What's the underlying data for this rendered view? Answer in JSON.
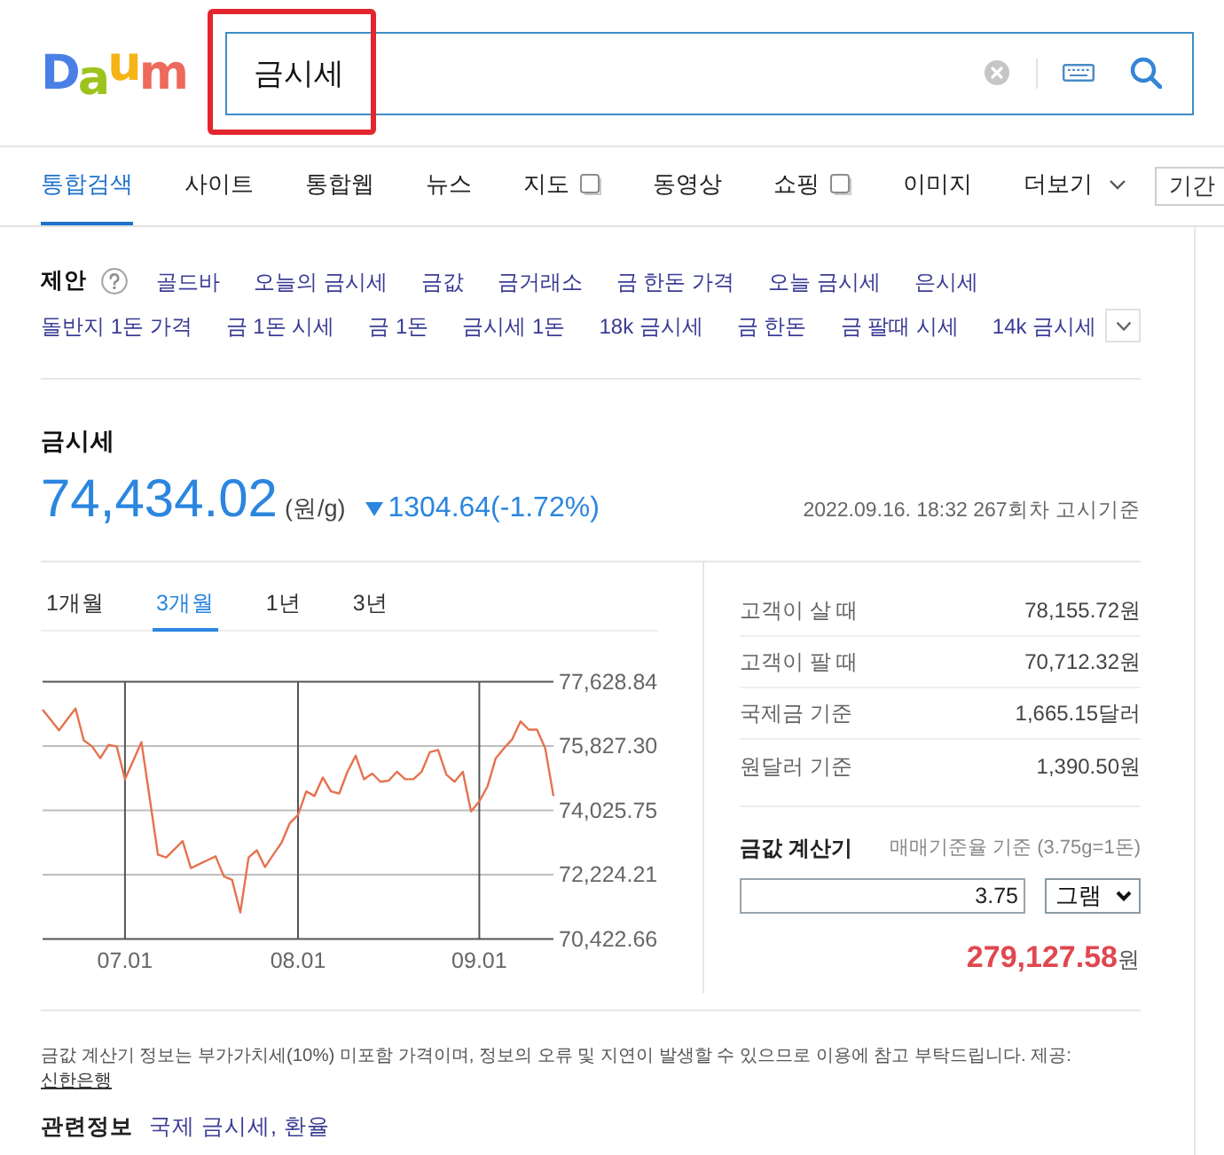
{
  "logo": "Daum",
  "search": {
    "query": "금시세",
    "highlighted": true
  },
  "nav": {
    "items": [
      {
        "label": "통합검색",
        "kind": "tab",
        "selected": true
      },
      {
        "label": "사이트",
        "kind": "tab",
        "selected": false
      },
      {
        "label": "통합웹",
        "kind": "tab",
        "selected": false
      },
      {
        "label": "뉴스",
        "kind": "tab",
        "selected": false
      },
      {
        "label": "지도",
        "kind": "popup_tab",
        "selected": false
      },
      {
        "label": "동영상",
        "kind": "tab",
        "selected": false
      },
      {
        "label": "쇼핑",
        "kind": "popup_tab",
        "selected": false
      },
      {
        "label": "이미지",
        "kind": "tab",
        "selected": false
      },
      {
        "label": "더보기",
        "kind": "more",
        "selected": false
      }
    ],
    "filter": "기간"
  },
  "suggestions": {
    "label": "제안",
    "rows": [
      [
        "골드바",
        "오늘의 금시세",
        "금값",
        "금거래소",
        "금 한돈 가격",
        "오늘 금시세",
        "은시세"
      ],
      [
        "돌반지 1돈 가격",
        "금 1돈 시세",
        "금 1돈",
        "금시세 1돈",
        "18k 금시세",
        "금 한돈",
        "금 팔때 시세",
        "14k 금시세"
      ]
    ]
  },
  "price": {
    "title": "금시세",
    "value": "74,434.02",
    "unit": "(원/g)",
    "change": {
      "down": true,
      "text": "1304.64(-1.72%)"
    },
    "timestamp": "2022.09.16. 18:32 267회차 고시기준"
  },
  "chart": {
    "tabs": [
      {
        "label": "1개월",
        "selected": false
      },
      {
        "label": "3개월",
        "selected": true
      },
      {
        "label": "1년",
        "selected": false
      },
      {
        "label": "3년",
        "selected": false
      }
    ],
    "chart_data": {
      "type": "line",
      "grid": true,
      "categories": [
        null,
        null,
        null,
        null,
        null,
        null,
        null,
        null,
        null,
        null,
        "07.01",
        null,
        null,
        null,
        null,
        null,
        null,
        null,
        null,
        null,
        null,
        null,
        null,
        null,
        null,
        null,
        null,
        null,
        null,
        null,
        null,
        "08.01",
        null,
        null,
        null,
        null,
        null,
        null,
        null,
        null,
        null,
        null,
        null,
        null,
        null,
        null,
        null,
        null,
        null,
        null,
        null,
        null,
        null,
        "09.01",
        null,
        null,
        null,
        null,
        null,
        null,
        null,
        null,
        null
      ],
      "series": [
        {
          "color": "#e5724f",
          "values": [
            76850,
            76560,
            76270,
            76580,
            76880,
            75990,
            75820,
            75490,
            75860,
            75820,
            74900,
            75420,
            75940,
            74370,
            72790,
            72710,
            72940,
            73170,
            72410,
            72520,
            72630,
            72740,
            72180,
            72080,
            71170,
            72710,
            72910,
            72440,
            72790,
            73120,
            73670,
            73900,
            74560,
            74430,
            74950,
            74560,
            74500,
            75110,
            75560,
            74900,
            75060,
            74830,
            74860,
            75110,
            74900,
            74900,
            75110,
            75660,
            75720,
            75030,
            74830,
            75110,
            74000,
            74280,
            74700,
            75490,
            75770,
            76020,
            76520,
            76290,
            76290,
            75770,
            74430
          ]
        }
      ],
      "ylim": [
        70422.66,
        77628.84
      ],
      "yticks": [
        {
          "value": 70422.66,
          "label": "70,422.66"
        },
        {
          "value": 72224.21,
          "label": "72,224.21"
        },
        {
          "value": 74025.75,
          "label": "74,025.75"
        },
        {
          "value": 75827.3,
          "label": "75,827.30"
        },
        {
          "value": 77628.84,
          "label": "77,628.84"
        }
      ]
    }
  },
  "rates": [
    {
      "label": "고객이 살 때",
      "value": "78,155.72원"
    },
    {
      "label": "고객이 팔 때",
      "value": "70,712.32원"
    },
    {
      "label": "국제금 기준",
      "value": "1,665.15달러"
    },
    {
      "label": "원달러 기준",
      "value": "1,390.50원"
    }
  ],
  "calculator": {
    "title": "금값 계산기",
    "note": "매매기준율 기준 (3.75g=1돈)",
    "amount": "3.75",
    "unit": "그램",
    "result": "279,127.58",
    "result_unit": "원"
  },
  "notice": {
    "text": "금값 계산기 정보는 부가가치세(10%) 미포함 가격이며, 정보의 오류 및 지연이 발생할 수 있으므로 이용에 참고 부탁드립니다. 제공:",
    "source_link": "신한은행"
  },
  "related": {
    "label": "관련정보",
    "links": [
      "국제 금시세",
      "환율"
    ],
    "separator": ","
  }
}
